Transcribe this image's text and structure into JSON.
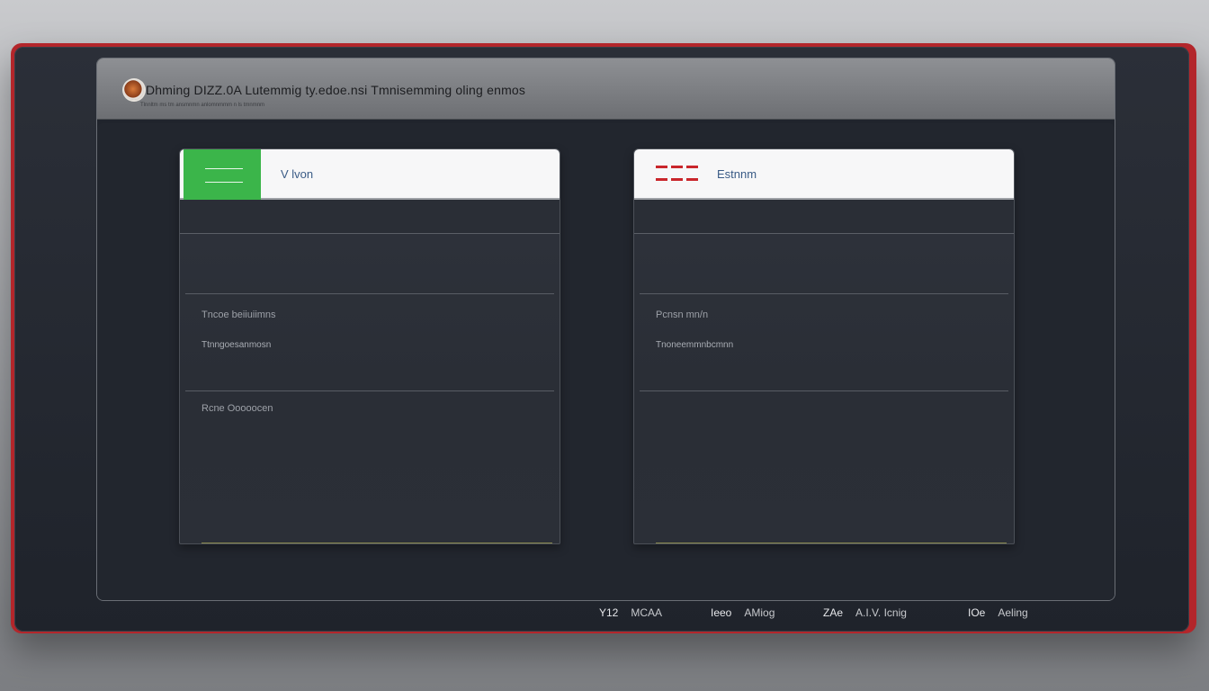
{
  "window": {
    "title": "Dhming  DIZZ.0A   Lutemmig ty.edoe.nsi  Tmnisemming  oling  enmos",
    "subtitle": "Tlnnltm ms tm ansmnmn anlomnmmm n ls tmnmnm"
  },
  "panels": [
    {
      "header_label": "V lvon",
      "accent": "#3bb54a",
      "section_title": "Tncoe beiiuiimns",
      "section_body": "Ttnngoesanmosn",
      "footer_label": "Rcne  Ooooocen"
    },
    {
      "header_label": "Estnnm",
      "accent": "#c9262b",
      "section_title": "Pcnsn mn/n",
      "section_body": "Tnoneemmnbcmnn",
      "footer_label": ""
    }
  ],
  "status_bar": [
    {
      "key": "Y12",
      "value": "MCAA"
    },
    {
      "key": "Ieeo",
      "value": "AMiog"
    },
    {
      "key": "ZAe",
      "value": "A.I.V.  Icnig"
    },
    {
      "key": "IOe",
      "value": "Aeling"
    }
  ]
}
